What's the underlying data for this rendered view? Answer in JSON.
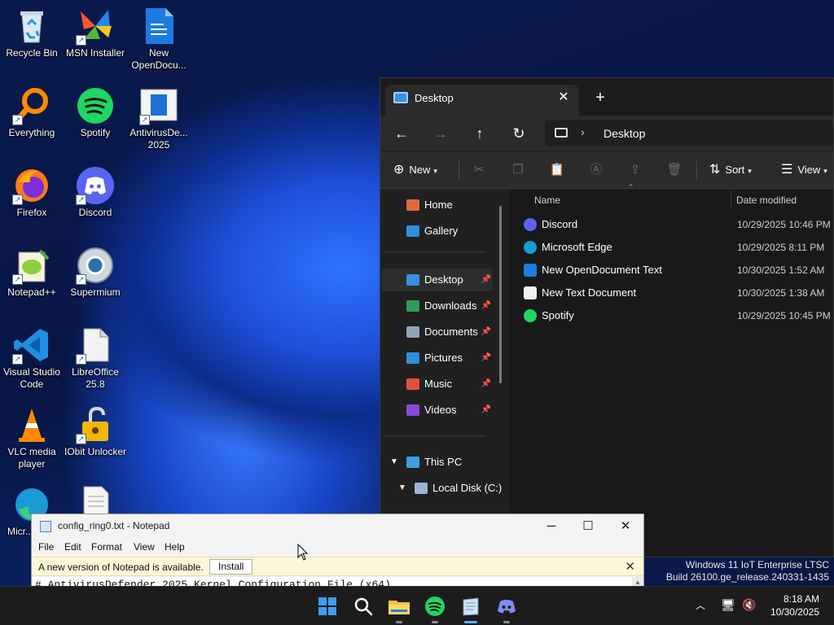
{
  "desktop": {
    "icons": [
      {
        "label": "Recycle Bin"
      },
      {
        "label": "MSN Installer"
      },
      {
        "label": "New OpenDocu..."
      },
      {
        "label": "Everything"
      },
      {
        "label": "Spotify"
      },
      {
        "label": "AntivirusDe... 2025"
      },
      {
        "label": "Firefox"
      },
      {
        "label": "Discord"
      },
      {
        "label": "Notepad++"
      },
      {
        "label": "Supermium"
      },
      {
        "label": "Visual Studio Code"
      },
      {
        "label": "LibreOffice 25.8"
      },
      {
        "label": "VLC media player"
      },
      {
        "label": "IObit Unlocker"
      },
      {
        "label": "Micr... Ed..."
      }
    ]
  },
  "explorer": {
    "tab_title": "Desktop",
    "tab_close": "✕",
    "new_tab": "+",
    "breadcrumb": "Desktop",
    "commands": {
      "new": "New",
      "sort": "Sort",
      "view": "View"
    },
    "nav": {
      "home": "Home",
      "gallery": "Gallery",
      "desktop": "Desktop",
      "downloads": "Downloads",
      "documents": "Documents",
      "pictures": "Pictures",
      "music": "Music",
      "videos": "Videos",
      "this_pc": "This PC",
      "local_disk": "Local Disk (C:)"
    },
    "columns": {
      "name": "Name",
      "date": "Date modified"
    },
    "files": [
      {
        "name": "Discord",
        "date": "10/29/2025 10:46 PM"
      },
      {
        "name": "Microsoft Edge",
        "date": "10/29/2025 8:11 PM"
      },
      {
        "name": "New OpenDocument Text",
        "date": "10/30/2025 1:52 AM"
      },
      {
        "name": "New Text Document",
        "date": "10/30/2025 1:38 AM"
      },
      {
        "name": "Spotify",
        "date": "10/29/2025 10:45 PM"
      }
    ]
  },
  "notepad": {
    "title": "config_ring0.txt - Notepad",
    "menu": {
      "file": "File",
      "edit": "Edit",
      "format": "Format",
      "view": "View",
      "help": "Help"
    },
    "update_message": "A new version of Notepad is available.",
    "install_label": "Install",
    "first_line": "# AntivirusDefender 2025 Kernel Configuration File (x64)"
  },
  "watermark": {
    "line1": "Windows 11 IoT Enterprise LTSC",
    "line2": "Build 26100.ge_release.240331-1435"
  },
  "taskbar": {
    "time": "8:18 AM",
    "date": "10/30/2025"
  }
}
